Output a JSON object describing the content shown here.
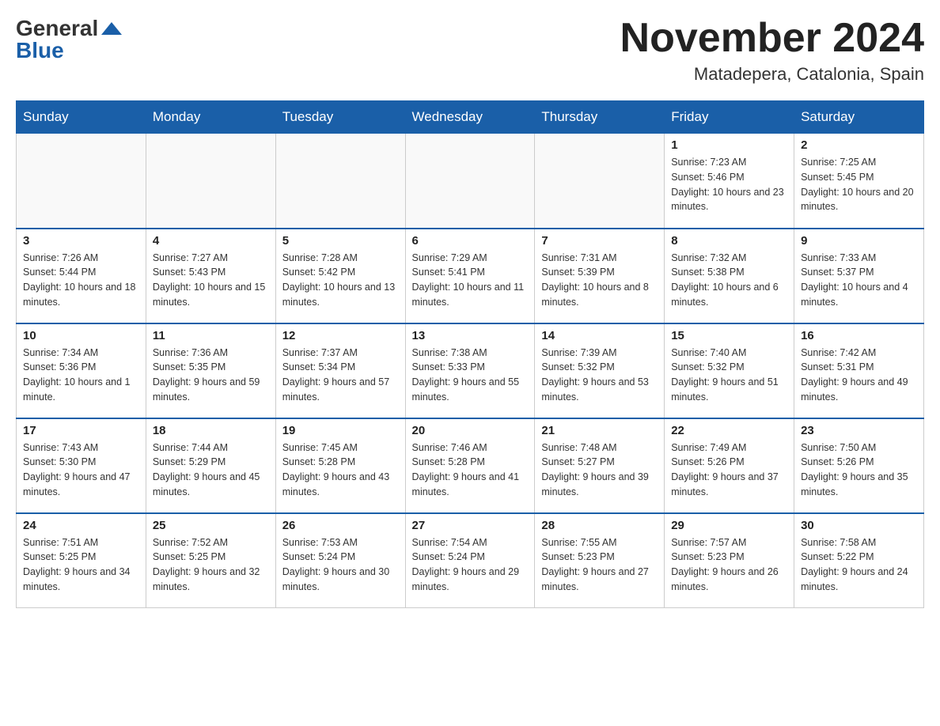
{
  "header": {
    "logo_general": "General",
    "logo_blue": "Blue",
    "month_title": "November 2024",
    "location": "Matadepera, Catalonia, Spain"
  },
  "weekdays": [
    "Sunday",
    "Monday",
    "Tuesday",
    "Wednesday",
    "Thursday",
    "Friday",
    "Saturday"
  ],
  "weeks": [
    [
      {
        "day": "",
        "info": ""
      },
      {
        "day": "",
        "info": ""
      },
      {
        "day": "",
        "info": ""
      },
      {
        "day": "",
        "info": ""
      },
      {
        "day": "",
        "info": ""
      },
      {
        "day": "1",
        "info": "Sunrise: 7:23 AM\nSunset: 5:46 PM\nDaylight: 10 hours and 23 minutes."
      },
      {
        "day": "2",
        "info": "Sunrise: 7:25 AM\nSunset: 5:45 PM\nDaylight: 10 hours and 20 minutes."
      }
    ],
    [
      {
        "day": "3",
        "info": "Sunrise: 7:26 AM\nSunset: 5:44 PM\nDaylight: 10 hours and 18 minutes."
      },
      {
        "day": "4",
        "info": "Sunrise: 7:27 AM\nSunset: 5:43 PM\nDaylight: 10 hours and 15 minutes."
      },
      {
        "day": "5",
        "info": "Sunrise: 7:28 AM\nSunset: 5:42 PM\nDaylight: 10 hours and 13 minutes."
      },
      {
        "day": "6",
        "info": "Sunrise: 7:29 AM\nSunset: 5:41 PM\nDaylight: 10 hours and 11 minutes."
      },
      {
        "day": "7",
        "info": "Sunrise: 7:31 AM\nSunset: 5:39 PM\nDaylight: 10 hours and 8 minutes."
      },
      {
        "day": "8",
        "info": "Sunrise: 7:32 AM\nSunset: 5:38 PM\nDaylight: 10 hours and 6 minutes."
      },
      {
        "day": "9",
        "info": "Sunrise: 7:33 AM\nSunset: 5:37 PM\nDaylight: 10 hours and 4 minutes."
      }
    ],
    [
      {
        "day": "10",
        "info": "Sunrise: 7:34 AM\nSunset: 5:36 PM\nDaylight: 10 hours and 1 minute."
      },
      {
        "day": "11",
        "info": "Sunrise: 7:36 AM\nSunset: 5:35 PM\nDaylight: 9 hours and 59 minutes."
      },
      {
        "day": "12",
        "info": "Sunrise: 7:37 AM\nSunset: 5:34 PM\nDaylight: 9 hours and 57 minutes."
      },
      {
        "day": "13",
        "info": "Sunrise: 7:38 AM\nSunset: 5:33 PM\nDaylight: 9 hours and 55 minutes."
      },
      {
        "day": "14",
        "info": "Sunrise: 7:39 AM\nSunset: 5:32 PM\nDaylight: 9 hours and 53 minutes."
      },
      {
        "day": "15",
        "info": "Sunrise: 7:40 AM\nSunset: 5:32 PM\nDaylight: 9 hours and 51 minutes."
      },
      {
        "day": "16",
        "info": "Sunrise: 7:42 AM\nSunset: 5:31 PM\nDaylight: 9 hours and 49 minutes."
      }
    ],
    [
      {
        "day": "17",
        "info": "Sunrise: 7:43 AM\nSunset: 5:30 PM\nDaylight: 9 hours and 47 minutes."
      },
      {
        "day": "18",
        "info": "Sunrise: 7:44 AM\nSunset: 5:29 PM\nDaylight: 9 hours and 45 minutes."
      },
      {
        "day": "19",
        "info": "Sunrise: 7:45 AM\nSunset: 5:28 PM\nDaylight: 9 hours and 43 minutes."
      },
      {
        "day": "20",
        "info": "Sunrise: 7:46 AM\nSunset: 5:28 PM\nDaylight: 9 hours and 41 minutes."
      },
      {
        "day": "21",
        "info": "Sunrise: 7:48 AM\nSunset: 5:27 PM\nDaylight: 9 hours and 39 minutes."
      },
      {
        "day": "22",
        "info": "Sunrise: 7:49 AM\nSunset: 5:26 PM\nDaylight: 9 hours and 37 minutes."
      },
      {
        "day": "23",
        "info": "Sunrise: 7:50 AM\nSunset: 5:26 PM\nDaylight: 9 hours and 35 minutes."
      }
    ],
    [
      {
        "day": "24",
        "info": "Sunrise: 7:51 AM\nSunset: 5:25 PM\nDaylight: 9 hours and 34 minutes."
      },
      {
        "day": "25",
        "info": "Sunrise: 7:52 AM\nSunset: 5:25 PM\nDaylight: 9 hours and 32 minutes."
      },
      {
        "day": "26",
        "info": "Sunrise: 7:53 AM\nSunset: 5:24 PM\nDaylight: 9 hours and 30 minutes."
      },
      {
        "day": "27",
        "info": "Sunrise: 7:54 AM\nSunset: 5:24 PM\nDaylight: 9 hours and 29 minutes."
      },
      {
        "day": "28",
        "info": "Sunrise: 7:55 AM\nSunset: 5:23 PM\nDaylight: 9 hours and 27 minutes."
      },
      {
        "day": "29",
        "info": "Sunrise: 7:57 AM\nSunset: 5:23 PM\nDaylight: 9 hours and 26 minutes."
      },
      {
        "day": "30",
        "info": "Sunrise: 7:58 AM\nSunset: 5:22 PM\nDaylight: 9 hours and 24 minutes."
      }
    ]
  ]
}
